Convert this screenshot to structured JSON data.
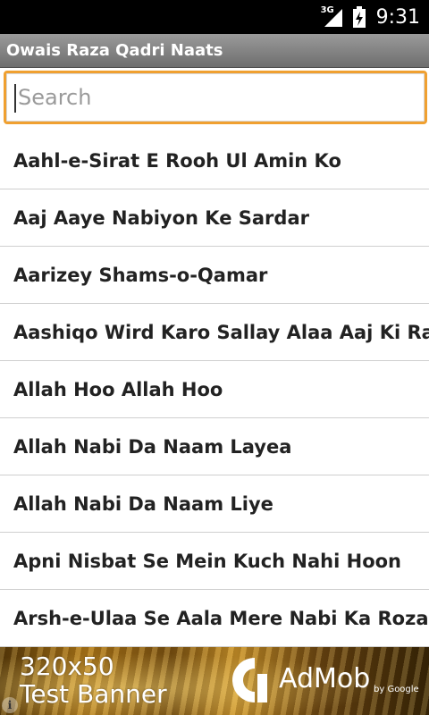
{
  "status_bar": {
    "network_label": "3G",
    "time": "9:31",
    "icons": [
      "signal-icon",
      "battery-charging-icon"
    ]
  },
  "app": {
    "title": "Owais Raza Qadri Naats"
  },
  "search": {
    "placeholder": "Search",
    "value": "",
    "accent_color": "#f0a030"
  },
  "list": {
    "items": [
      "Aahl-e-Sirat E Rooh Ul Amin Ko",
      "Aaj Aaye Nabiyon Ke Sardar",
      "Aarizey Shams-o-Qamar",
      "Aashiqo Wird Karo Sallay Alaa Aaj Ki Raat",
      "Allah Hoo Allah Hoo",
      "Allah Nabi Da Naam Layea",
      "Allah Nabi Da Naam Liye",
      "Apni Nisbat Se Mein Kuch Nahi Hoon",
      "Arsh-e-Ulaa Se Aala Mere Nabi Ka Roza"
    ]
  },
  "ad_banner": {
    "line1": "320x50",
    "line2": "Test Banner",
    "brand": "AdMob",
    "by_label": "by Google",
    "info_icon": "i"
  }
}
